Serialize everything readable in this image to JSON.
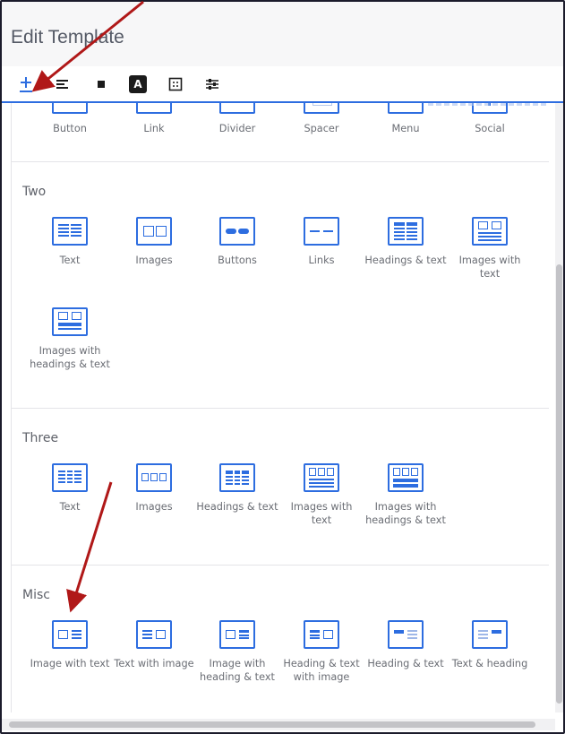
{
  "window": {
    "title": "Edit Template"
  },
  "toolbar": {
    "buttons": [
      {
        "name": "add",
        "icon": "plus-icon",
        "active": true
      },
      {
        "name": "text-align",
        "icon": "align-left-icon"
      },
      {
        "name": "block",
        "icon": "square-icon"
      },
      {
        "name": "font",
        "icon": "font-icon",
        "glyph": "A"
      },
      {
        "name": "layout",
        "icon": "grid-dots-icon"
      },
      {
        "name": "settings",
        "icon": "sliders-icon"
      }
    ]
  },
  "sections": {
    "one": {
      "items": [
        "Button",
        "Link",
        "Divider",
        "Spacer",
        "Menu",
        "Social"
      ]
    },
    "two": {
      "title": "Two",
      "items": [
        "Text",
        "Images",
        "Buttons",
        "Links",
        "Headings & text",
        "Images with text",
        "Images with headings & text"
      ]
    },
    "three": {
      "title": "Three",
      "items": [
        "Text",
        "Images",
        "Headings & text",
        "Images with text",
        "Images with headings & text"
      ]
    },
    "misc": {
      "title": "Misc",
      "items": [
        "Image with text",
        "Text with image",
        "Image with heading & text",
        "Heading & text with image",
        "Heading & text",
        "Text & heading"
      ]
    }
  },
  "colors": {
    "accent": "#2d6de0",
    "annotation_arrow": "#b01818",
    "label": "#6a6d74"
  }
}
